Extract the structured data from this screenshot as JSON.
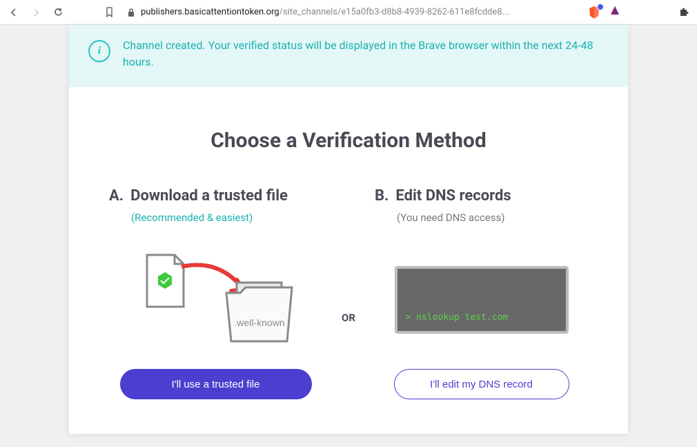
{
  "browser": {
    "url_domain": "publishers.basicattentiontoken.org",
    "url_path": "/site_channels/e15a0fb3-d8b8-4939-8262-611e8fcdde8..."
  },
  "alert": {
    "icon_glyph": "i",
    "text": "Channel created. Your verified status will be displayed in the Brave browser within the next 24-48 hours."
  },
  "heading": "Choose a Verification Method",
  "option_a": {
    "letter": "A.",
    "title": "Download a trusted file",
    "subtitle": "(Recommended & easiest)",
    "illus_folder_label": ".well-known",
    "button_label": "I'll use a trusted file"
  },
  "separator": "OR",
  "option_b": {
    "letter": "B.",
    "title": "Edit DNS records",
    "subtitle": "(You need DNS access)",
    "terminal_text": "> nslookup test.com",
    "button_label": "I'll edit my DNS record"
  }
}
